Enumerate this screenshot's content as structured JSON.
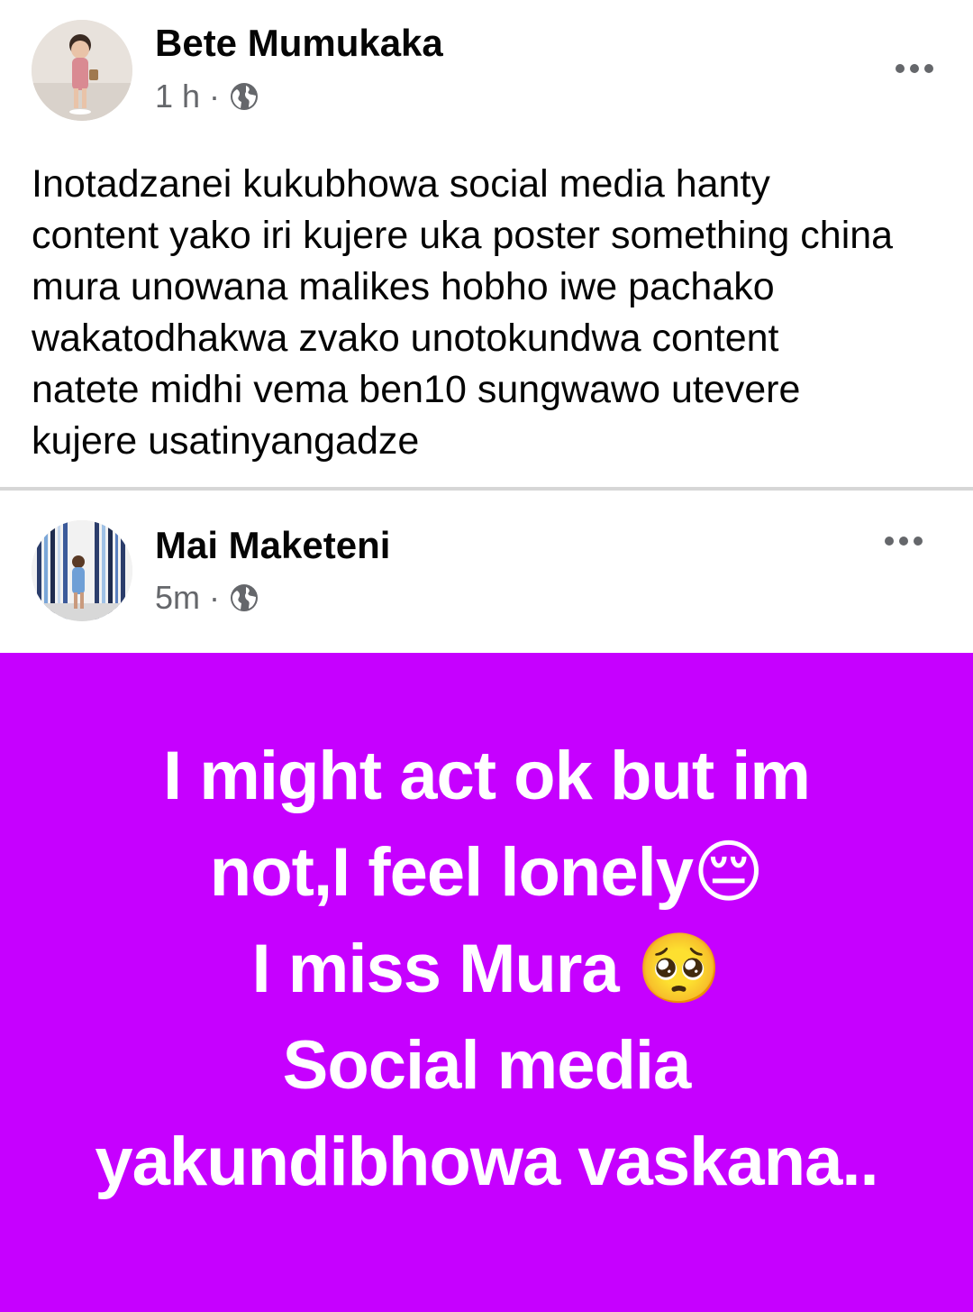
{
  "posts": [
    {
      "author": "Bete Mumukaka",
      "time": "1 h",
      "separator": "·",
      "audience_icon": "globe-icon",
      "more_icon": "more-options-icon",
      "text": "Inotadzanei kukubhowa social media hanty\ncontent yako iri kujere uka poster something china\nmura unowana malikes hobho iwe pachako\nwakatodhakwa zvako unotokundwa content\nnatete midhi vema ben10 sungwawo utevere\nkujere usatinyangadze"
    },
    {
      "author": "Mai Maketeni",
      "time": "5m",
      "separator": "·",
      "audience_icon": "globe-icon",
      "more_icon": "more-options-icon",
      "background_color": "#c600ff",
      "text": "I might act ok but im\nnot,I feel lonely😔\nI miss Mura 🥺\nSocial media\nyakundibhowa vaskana.."
    }
  ]
}
